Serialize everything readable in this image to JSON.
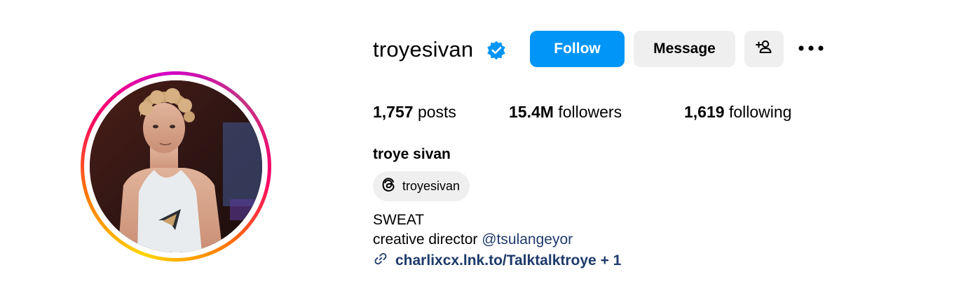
{
  "profile": {
    "username": "troyesivan",
    "full_name": "troye sivan",
    "verified_icon": "verified-badge-icon",
    "verified_color": "#0095f6"
  },
  "actions": {
    "follow_label": "Follow",
    "message_label": "Message",
    "suggest_icon": "add-person-icon",
    "more_icon": "more-horizontal-icon"
  },
  "stats": {
    "posts_count": "1,757",
    "posts_label": "posts",
    "followers_count": "15.4M",
    "followers_label": "followers",
    "following_count": "1,619",
    "following_label": "following"
  },
  "threads": {
    "icon": "threads-icon",
    "handle": "troyesivan"
  },
  "bio": {
    "line1": "SWEAT",
    "line2_prefix": "creative director ",
    "line2_mention": "@tsulangeyor",
    "link_icon": "link-icon",
    "link_text": "charlixcx.lnk.to/Talktalktroye + 1"
  },
  "colors": {
    "accent": "#0095f6",
    "button_secondary": "#efefef",
    "link": "#1e3a6b"
  }
}
